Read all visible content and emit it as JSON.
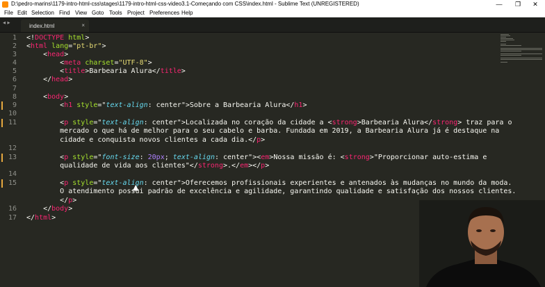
{
  "window": {
    "title": "D:\\pedro-marins\\1179-intro-html-css\\stages\\1179-intro-html-css-video3.1-Começando com CSS\\index.html - Sublime Text (UNREGISTERED)",
    "minimize": "—",
    "maximize": "❐",
    "close": "✕"
  },
  "menu": [
    "File",
    "Edit",
    "Selection",
    "Find",
    "View",
    "Goto",
    "Tools",
    "Project",
    "Preferences",
    "Help"
  ],
  "nav": {
    "arrows": "◂ ▸"
  },
  "tab": {
    "name": "index.html",
    "close": "×"
  },
  "line_numbers": [
    "1",
    "2",
    "3",
    "4",
    "5",
    "6",
    "7",
    "8",
    "9",
    "10",
    "11",
    "",
    "",
    "12",
    "13",
    "",
    "14",
    "15",
    "",
    "",
    "16",
    "17"
  ],
  "code": {
    "l1a": "<!",
    "l1b": "DOCTYPE",
    "l1c": " ",
    "l1d": "html",
    "l1e": ">",
    "l2a": "<",
    "l2b": "html",
    "l2c": " ",
    "l2d": "lang",
    "l2e": "=",
    "l2f": "\"pt-br\"",
    "l2g": ">",
    "l3a": "    <",
    "l3b": "head",
    "l3c": ">",
    "l4a": "        <",
    "l4b": "meta",
    "l4c": " ",
    "l4d": "charset",
    "l4e": "=",
    "l4f": "\"UTF-8\"",
    "l4g": ">",
    "l5a": "        <",
    "l5b": "title",
    "l5c": ">Barbearia Alura</",
    "l5d": "title",
    "l5e": ">",
    "l6a": "    </",
    "l6b": "head",
    "l6c": ">",
    "l8a": "    <",
    "l8b": "body",
    "l8c": ">",
    "l9a": "        <",
    "l9b": "h1",
    "l9c": " ",
    "l9d": "style",
    "l9e": "=\"",
    "l9f": "text-align",
    "l9g": ": center",
    "l9h": "\"",
    "l9i": ">Sobre a Barbearia Alura</",
    "l9j": "h1",
    "l9k": ">",
    "l11a": "        <",
    "l11b": "p",
    "l11c": " ",
    "l11d": "style",
    "l11e": "=\"",
    "l11f": "text-align",
    "l11g": ": center",
    "l11h": "\"",
    "l11i": ">Localizada no coração da cidade a <",
    "l11j": "strong",
    "l11k": ">Barbearia Alura</",
    "l11l": "strong",
    "l11m": "> traz para o",
    "l11w1": "        mercado o que há de melhor para o seu cabelo e barba. Fundada em 2019, a Barbearia Alura já é destaque na",
    "l11w2a": "        cidade e conquista novos clientes a cada dia.</",
    "l11w2b": "p",
    "l11w2c": ">",
    "l13a": "        <",
    "l13b": "p",
    "l13c": " ",
    "l13d": "style",
    "l13e": "=\"",
    "l13f": "font-size",
    "l13g": ": ",
    "l13h": "20px",
    "l13i": "; ",
    "l13j": "text-align",
    "l13k": ": center",
    "l13l": "\"",
    "l13m": "><",
    "l13n": "em",
    "l13o": ">Nossa missão é: <",
    "l13p": "strong",
    "l13q": ">\"Proporcionar auto-estima e",
    "l13w1a": "        qualidade de vida aos clientes\"</",
    "l13w1b": "strong",
    "l13w1c": ">.</",
    "l13w1d": "em",
    "l13w1e": "></",
    "l13w1f": "p",
    "l13w1g": ">",
    "l15a": "        <",
    "l15b": "p",
    "l15c": " ",
    "l15d": "style",
    "l15e": "=\"",
    "l15f": "text-align",
    "l15g": ": center",
    "l15h": "\"",
    "l15i": ">Oferecemos profissionais experientes e antenados às mudanças no mundo da moda.",
    "l15w1": "        O atendimento possui padrão de excelência e agilidade, garantindo qualidade e satisfação dos nossos clientes.",
    "l15w2a": "        </",
    "l15w2b": "p",
    "l15w2c": ">",
    "l16a": "    </",
    "l16b": "body",
    "l16c": ">",
    "l17a": "</",
    "l17b": "html",
    "l17c": ">"
  },
  "colors": {
    "background": "#272822",
    "tag": "#f92672",
    "attribute": "#a6e22e",
    "string": "#e6db74",
    "property": "#66d9ef",
    "number": "#ae81ff"
  }
}
